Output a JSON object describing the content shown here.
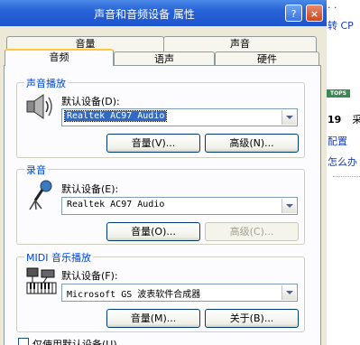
{
  "window": {
    "title": "声音和音频设备 属性",
    "help_label": "?",
    "close_label": "×"
  },
  "tabs_back": [
    "音量",
    "声音"
  ],
  "tabs_front": [
    "音频",
    "语声",
    "硬件"
  ],
  "playback": {
    "group_label": "声音播放",
    "default_label": "默认设备(D):",
    "device": "Realtek AC97 Audio",
    "volume_button": "音量(V)...",
    "advanced_button": "高级(N)..."
  },
  "recording": {
    "group_label": "录音",
    "default_label": "默认设备(E):",
    "device": "Realtek AC97 Audio",
    "volume_button": "音量(O)...",
    "advanced_button": "高级(C)..."
  },
  "midi": {
    "group_label": "MIDI 音乐播放",
    "default_label": "默认设备(F):",
    "device": "Microsoft GS 波表软件合成器",
    "volume_button": "音量(M)...",
    "about_button": "关于(B)..."
  },
  "bottom_checkbox": "仅使用默认设备(U)",
  "background": {
    "text1": "转 CP",
    "badge": "TOPS",
    "num": "19",
    "num2": "采",
    "link1": "配置",
    "link2": "怎么办"
  }
}
